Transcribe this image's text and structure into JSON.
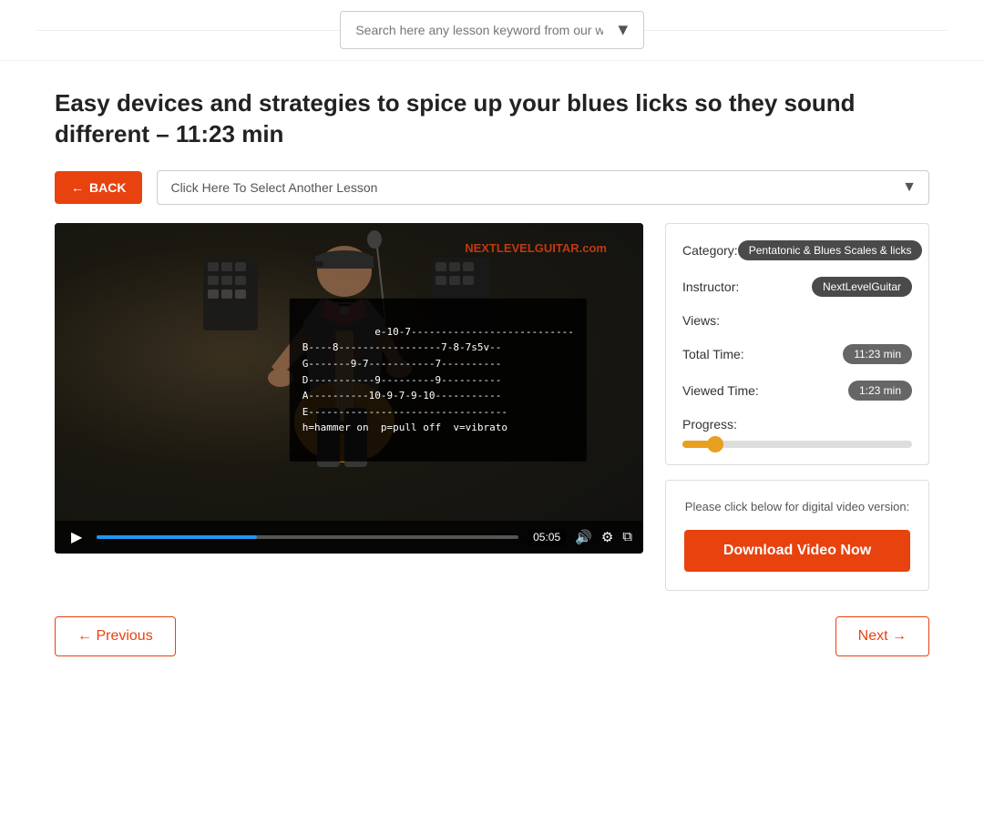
{
  "search": {
    "placeholder": "Search here any lesson keyword from our website ..."
  },
  "page": {
    "title": "Easy devices and strategies to spice up your blues licks so they sound different – 11:23 min"
  },
  "controls": {
    "back_label": "BACK",
    "lesson_select_placeholder": "Click Here To Select Another Lesson"
  },
  "video": {
    "timestamp": "05:05",
    "brand": "NEXTLEVELGUITAR.com",
    "tablature": "e-10-7---------------------------\nB----8-----------------7-8-7s5v--\nG-------9-7-----------7----------\nD-----------9---------9----------\nA----------10-9-7-9-10-----------\nE---------------------------------\nh=hammer on  p=pull off  v=vibrato"
  },
  "info": {
    "category_label": "Category:",
    "category_value": "Pentatonic & Blues Scales & licks",
    "instructor_label": "Instructor:",
    "instructor_value": "NextLevelGuitar",
    "views_label": "Views:",
    "views_value": "",
    "total_time_label": "Total Time:",
    "total_time_value": "11:23 min",
    "viewed_time_label": "Viewed Time:",
    "viewed_time_value": "1:23 min",
    "progress_label": "Progress:",
    "progress_percent": 12
  },
  "download": {
    "description": "Please click below for digital video version:",
    "button_label": "Download Video Now"
  },
  "navigation": {
    "previous_label": "← Previous",
    "next_label": "Next →"
  }
}
